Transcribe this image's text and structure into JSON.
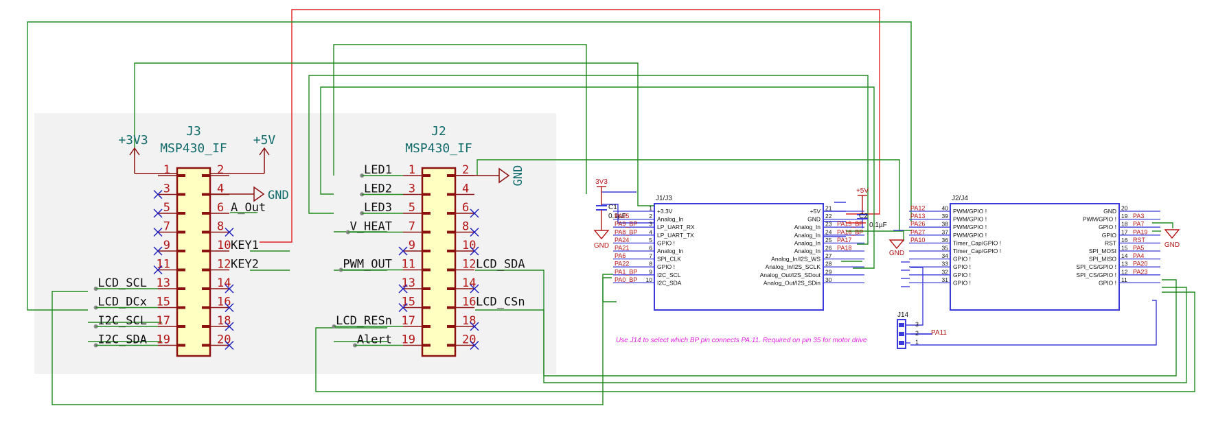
{
  "colors": {
    "wire": "#1f8a1f",
    "red_wire": "#e02020",
    "body_fill": "#ffffc2",
    "body_stroke": "#8b1010",
    "pin_num": "#b41414",
    "power": "#116b6b",
    "noconnect": "#1f1fbf",
    "ic_stroke": "#3b3bdb",
    "note": "#e020e0"
  },
  "j3": {
    "ref": "J3",
    "value": "MSP430_IF",
    "pwr_left": "+3V3",
    "pwr_right": "+5V",
    "gnd": "GND",
    "left_pins": [
      {
        "num": "1",
        "label": ""
      },
      {
        "num": "3",
        "label": ""
      },
      {
        "num": "5",
        "label": ""
      },
      {
        "num": "7",
        "label": ""
      },
      {
        "num": "9",
        "label": ""
      },
      {
        "num": "11",
        "label": ""
      },
      {
        "num": "13",
        "label": "LCD_SCL"
      },
      {
        "num": "15",
        "label": "LCD_DCx"
      },
      {
        "num": "17",
        "label": "I2C_SCL"
      },
      {
        "num": "19",
        "label": "I2C_SDA"
      }
    ],
    "right_pins": [
      {
        "num": "2",
        "label": ""
      },
      {
        "num": "4",
        "label": ""
      },
      {
        "num": "6",
        "label": "A_Out"
      },
      {
        "num": "8",
        "label": ""
      },
      {
        "num": "10",
        "label": "KEY1"
      },
      {
        "num": "12",
        "label": "KEY2"
      },
      {
        "num": "14",
        "label": ""
      },
      {
        "num": "16",
        "label": ""
      },
      {
        "num": "18",
        "label": ""
      },
      {
        "num": "20",
        "label": ""
      }
    ]
  },
  "j2": {
    "ref": "J2",
    "value": "MSP430_IF",
    "gnd": "GND",
    "left_pins": [
      {
        "num": "1",
        "label": "LED1"
      },
      {
        "num": "3",
        "label": "LED2"
      },
      {
        "num": "5",
        "label": "LED3"
      },
      {
        "num": "7",
        "label": "V_HEAT"
      },
      {
        "num": "9",
        "label": ""
      },
      {
        "num": "11",
        "label": "PWM_OUT"
      },
      {
        "num": "13",
        "label": ""
      },
      {
        "num": "15",
        "label": ""
      },
      {
        "num": "17",
        "label": "LCD_RESn"
      },
      {
        "num": "19",
        "label": "Alert"
      }
    ],
    "right_pins": [
      {
        "num": "2",
        "label": ""
      },
      {
        "num": "4",
        "label": ""
      },
      {
        "num": "6",
        "label": ""
      },
      {
        "num": "8",
        "label": ""
      },
      {
        "num": "10",
        "label": ""
      },
      {
        "num": "12",
        "label": "LCD_SDA"
      },
      {
        "num": "14",
        "label": ""
      },
      {
        "num": "16",
        "label": "LCD_CSn"
      },
      {
        "num": "18",
        "label": ""
      },
      {
        "num": "20",
        "label": ""
      }
    ]
  },
  "j1j3_block": {
    "title": "J1/J3",
    "left_pins": [
      {
        "net": "",
        "num": "1",
        "func": "+3.3V"
      },
      {
        "net": "PA25",
        "num": "2",
        "func": "Analog_In"
      },
      {
        "net": "PA9_BP",
        "num": "3",
        "func": "LP_UART_RX"
      },
      {
        "net": "PA8_BP",
        "num": "4",
        "func": "LP_UART_TX"
      },
      {
        "net": "PA24",
        "num": "5",
        "func": "GPIO !"
      },
      {
        "net": "PA21",
        "num": "6",
        "func": "Analog_In"
      },
      {
        "net": "PA6",
        "num": "7",
        "func": "SPI_CLK"
      },
      {
        "net": "PA22",
        "num": "8",
        "func": "GPIO !"
      },
      {
        "net": "PA1_BP",
        "num": "9",
        "func": "I2C_SCL"
      },
      {
        "net": "PA0_BP",
        "num": "10",
        "func": "I2C_SDA"
      }
    ],
    "right_pins": [
      {
        "func": "+5V",
        "num": "21",
        "net": ""
      },
      {
        "func": "GND",
        "num": "22",
        "net": ""
      },
      {
        "func": "Analog_In",
        "num": "23",
        "net": "PA15_BP"
      },
      {
        "func": "Analog_In",
        "num": "24",
        "net": "PA16_BP"
      },
      {
        "func": "Analog_In",
        "num": "25",
        "net": "PA17"
      },
      {
        "func": "Analog_In",
        "num": "26",
        "net": "PA18"
      },
      {
        "func": "Analog_In/I2S_WS",
        "num": "27",
        "net": ""
      },
      {
        "func": "Analog_In/I2S_SCLK",
        "num": "28",
        "net": ""
      },
      {
        "func": "Analog_Out/I2S_SDout",
        "num": "29",
        "net": ""
      },
      {
        "func": "Analog_Out/I2S_SDin",
        "num": "30",
        "net": ""
      }
    ]
  },
  "j2j4_block": {
    "title": "J2/J4",
    "left_pins": [
      {
        "net": "PA12",
        "num": "40",
        "func": "PWM/GPIO !"
      },
      {
        "net": "PA13",
        "num": "39",
        "func": "PWM/GPIO !"
      },
      {
        "net": "PA26",
        "num": "38",
        "func": "PWM/GPIO !"
      },
      {
        "net": "PA27",
        "num": "37",
        "func": "PWM/GPIO !"
      },
      {
        "net": "PA10",
        "num": "36",
        "func": "Timer_Cap/GPIO !"
      },
      {
        "net": "",
        "num": "35",
        "func": "Timer_Cap/GPIO !"
      },
      {
        "net": "",
        "num": "34",
        "func": "GPIO !"
      },
      {
        "net": "",
        "num": "33",
        "func": "GPIO !"
      },
      {
        "net": "",
        "num": "32",
        "func": "GPIO !"
      },
      {
        "net": "",
        "num": "31",
        "func": "GPIO !"
      }
    ],
    "right_pins": [
      {
        "func": "GND",
        "num": "20",
        "net": ""
      },
      {
        "func": "PWM/GPIO !",
        "num": "19",
        "net": "PA3"
      },
      {
        "func": "GPIO !",
        "num": "18",
        "net": "PA7"
      },
      {
        "func": "GPIO",
        "num": "17",
        "net": "PA19"
      },
      {
        "func": "RST",
        "num": "16",
        "net": "RST"
      },
      {
        "func": "SPI_MOSI",
        "num": "15",
        "net": "PA5"
      },
      {
        "func": "SPI_MISO",
        "num": "14",
        "net": "PA4"
      },
      {
        "func": "SPI_CS/GPIO !",
        "num": "13",
        "net": "PA20"
      },
      {
        "func": "SPI_CS/GPIO !",
        "num": "12",
        "net": "PA23"
      },
      {
        "func": "GPIO !",
        "num": "11",
        "net": ""
      }
    ]
  },
  "c1": {
    "ref": "C1",
    "value": "0.1µF",
    "supply": "3V3",
    "gnd": "GND"
  },
  "c2": {
    "ref": "C2",
    "value": "0.1µF",
    "supply": "+5V",
    "gnd": "GND"
  },
  "gnd_right": "GND",
  "j14": {
    "ref": "J14",
    "pins": [
      "3",
      "2",
      "1"
    ],
    "net": "PA11"
  },
  "note": "Use J14 to select which BP pin connects PA.11.  Required on pin 35 for motor drive"
}
